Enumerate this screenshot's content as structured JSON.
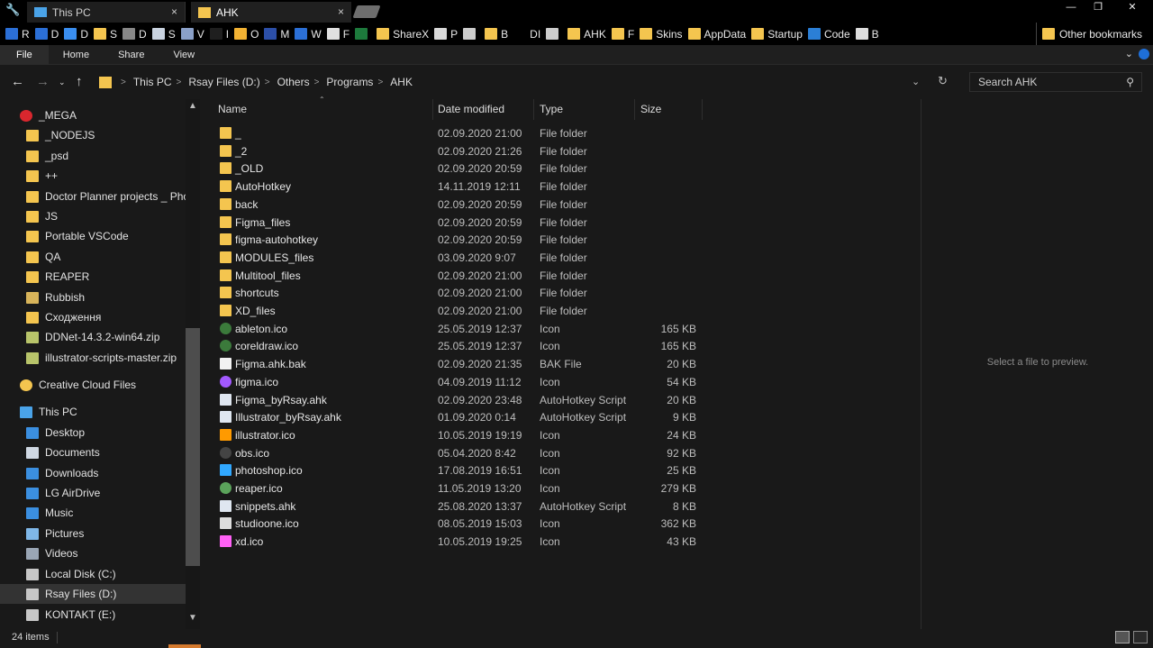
{
  "tabs": {
    "inactive_label": "This PC",
    "active_label": "AHK",
    "close_glyph": "×"
  },
  "window_controls": {
    "minimize": "—",
    "maximize": "❐",
    "close": "✕"
  },
  "bookmarks": [
    {
      "label": "R",
      "color": "#2b6fd6"
    },
    {
      "label": "D",
      "color": "#2b6fd6"
    },
    {
      "label": "D",
      "color": "#3a8ef0"
    },
    {
      "label": "S",
      "color": "#f4c54f"
    },
    {
      "label": "D",
      "color": "#888888"
    },
    {
      "label": "S",
      "color": "#c9d3e0"
    },
    {
      "label": "V",
      "color": "#8aa0c8"
    },
    {
      "label": "I",
      "color": "#1f1f1f"
    },
    {
      "label": "O",
      "color": "#f2b233"
    },
    {
      "label": "M",
      "color": "#2c4fa8"
    },
    {
      "label": "W",
      "color": "#2b6fd6"
    },
    {
      "label": "F",
      "color": "#e0e0e0"
    },
    {
      "label": "",
      "color": "#1d7a3c"
    },
    {
      "label": "ShareX",
      "color": "#f4c54f"
    },
    {
      "label": "P",
      "color": "#d9d9d9"
    },
    {
      "label": "",
      "color": "#cccccc"
    },
    {
      "label": "B",
      "color": "#f4c54f"
    },
    {
      "label": "DI",
      "color": "#000000"
    },
    {
      "label": "",
      "color": "#cccccc"
    },
    {
      "label": "AHK",
      "color": "#f4c54f"
    },
    {
      "label": "F",
      "color": "#f4c54f"
    },
    {
      "label": "Skins",
      "color": "#f4c54f"
    },
    {
      "label": "AppData",
      "color": "#f4c54f"
    },
    {
      "label": "Startup",
      "color": "#f4c54f"
    },
    {
      "label": "Code",
      "color": "#2b7fd6"
    },
    {
      "label": "B",
      "color": "#dddddd"
    }
  ],
  "other_bookmarks": "Other bookmarks",
  "ribbon": {
    "file": "File",
    "home": "Home",
    "share": "Share",
    "view": "View"
  },
  "address": {
    "crumbs": [
      "This PC",
      "Rsay Files (D:)",
      "Others",
      "Programs",
      "AHK"
    ],
    "separator": ">"
  },
  "search": {
    "placeholder": "Search AHK"
  },
  "nav_pane": {
    "items": [
      {
        "label": "_MEGA",
        "icon": "mega-icon",
        "color": "#d9272e",
        "indent": 0
      },
      {
        "label": "_NODEJS",
        "icon": "folder-sync-icon",
        "color": "#f4c54f",
        "indent": 1
      },
      {
        "label": "_psd",
        "icon": "folder-sync-icon",
        "color": "#f4c54f",
        "indent": 1
      },
      {
        "label": "++",
        "icon": "folder-sync-icon",
        "color": "#f4c54f",
        "indent": 1
      },
      {
        "label": "Doctor Planner projects _ Photo",
        "icon": "folder-icon",
        "color": "#f4c54f",
        "indent": 1
      },
      {
        "label": "JS",
        "icon": "folder-sync-icon",
        "color": "#f4c54f",
        "indent": 1
      },
      {
        "label": "Portable VSCode",
        "icon": "folder-sync-icon",
        "color": "#f4c54f",
        "indent": 1
      },
      {
        "label": "QA",
        "icon": "folder-sync-icon",
        "color": "#f4c54f",
        "indent": 1
      },
      {
        "label": "REAPER",
        "icon": "folder-sync-icon",
        "color": "#f4c54f",
        "indent": 1
      },
      {
        "label": "Rubbish",
        "icon": "folder-icon",
        "color": "#d8b45a",
        "indent": 1
      },
      {
        "label": "Сходження",
        "icon": "folder-sync-icon",
        "color": "#f4c54f",
        "indent": 1
      },
      {
        "label": "DDNet-14.3.2-win64.zip",
        "icon": "zip-icon",
        "color": "#b8c46a",
        "indent": 1
      },
      {
        "label": "illustrator-scripts-master.zip",
        "icon": "zip-icon",
        "color": "#b8c46a",
        "indent": 1
      },
      {
        "label": "Creative Cloud Files",
        "icon": "creative-cloud-icon",
        "color": "#f4c54f",
        "indent": 0
      },
      {
        "label": "This PC",
        "icon": "computer-icon",
        "color": "#4aa3e8",
        "indent": 0
      },
      {
        "label": "Desktop",
        "icon": "desktop-icon",
        "color": "#3b8fe0",
        "indent": 1
      },
      {
        "label": "Documents",
        "icon": "documents-icon",
        "color": "#cfd8e3",
        "indent": 1
      },
      {
        "label": "Downloads",
        "icon": "downloads-icon",
        "color": "#3b8fe0",
        "indent": 1
      },
      {
        "label": "LG AirDrive",
        "icon": "drive-icon",
        "color": "#3b8fe0",
        "indent": 1
      },
      {
        "label": "Music",
        "icon": "music-icon",
        "color": "#3b8fe0",
        "indent": 1
      },
      {
        "label": "Pictures",
        "icon": "pictures-icon",
        "color": "#7fb7e8",
        "indent": 1
      },
      {
        "label": "Videos",
        "icon": "videos-icon",
        "color": "#9aa6b5",
        "indent": 1
      },
      {
        "label": "Local Disk (C:)",
        "icon": "disk-icon",
        "color": "#c7c7c7",
        "indent": 1
      },
      {
        "label": "Rsay Files (D:)",
        "icon": "disk-icon",
        "color": "#c7c7c7",
        "indent": 1,
        "selected": true
      },
      {
        "label": "KONTAKT (E:)",
        "icon": "disk-icon",
        "color": "#c7c7c7",
        "indent": 1
      }
    ]
  },
  "columns": {
    "name": "Name",
    "date": "Date modified",
    "type": "Type",
    "size": "Size"
  },
  "files": [
    {
      "name": "_",
      "date": "02.09.2020 21:00",
      "type": "File folder",
      "size": "",
      "icon": "folder-icon",
      "color": "#f4c54f"
    },
    {
      "name": "_2",
      "date": "02.09.2020 21:26",
      "type": "File folder",
      "size": "",
      "icon": "folder-icon",
      "color": "#f4c54f"
    },
    {
      "name": "_OLD",
      "date": "02.09.2020 20:59",
      "type": "File folder",
      "size": "",
      "icon": "folder-icon",
      "color": "#f4c54f"
    },
    {
      "name": "AutoHotkey",
      "date": "14.11.2019 12:11",
      "type": "File folder",
      "size": "",
      "icon": "folder-icon",
      "color": "#f4c54f"
    },
    {
      "name": "back",
      "date": "02.09.2020 20:59",
      "type": "File folder",
      "size": "",
      "icon": "folder-icon",
      "color": "#f4c54f"
    },
    {
      "name": "Figma_files",
      "date": "02.09.2020 20:59",
      "type": "File folder",
      "size": "",
      "icon": "folder-icon",
      "color": "#f4c54f"
    },
    {
      "name": "figma-autohotkey",
      "date": "02.09.2020 20:59",
      "type": "File folder",
      "size": "",
      "icon": "folder-icon",
      "color": "#f4c54f"
    },
    {
      "name": "MODULES_files",
      "date": "03.09.2020 9:07",
      "type": "File folder",
      "size": "",
      "icon": "folder-icon",
      "color": "#f4c54f"
    },
    {
      "name": "Multitool_files",
      "date": "02.09.2020 21:00",
      "type": "File folder",
      "size": "",
      "icon": "folder-icon",
      "color": "#f4c54f"
    },
    {
      "name": "shortcuts",
      "date": "02.09.2020 21:00",
      "type": "File folder",
      "size": "",
      "icon": "folder-icon",
      "color": "#f4c54f"
    },
    {
      "name": "XD_files",
      "date": "02.09.2020 21:00",
      "type": "File folder",
      "size": "",
      "icon": "folder-icon",
      "color": "#f4c54f"
    },
    {
      "name": "ableton.ico",
      "date": "25.05.2019 12:37",
      "type": "Icon",
      "size": "165 KB",
      "icon": "ableton-icon",
      "color": "#3b7a3b"
    },
    {
      "name": "coreldraw.ico",
      "date": "25.05.2019 12:37",
      "type": "Icon",
      "size": "165 KB",
      "icon": "coreldraw-icon",
      "color": "#3b7a3b"
    },
    {
      "name": "Figma.ahk.bak",
      "date": "02.09.2020 21:35",
      "type": "BAK File",
      "size": "20 KB",
      "icon": "file-icon",
      "color": "#f2f2f2"
    },
    {
      "name": "figma.ico",
      "date": "04.09.2019 11:12",
      "type": "Icon",
      "size": "54 KB",
      "icon": "figma-icon",
      "color": "#a259ff"
    },
    {
      "name": "Figma_byRsay.ahk",
      "date": "02.09.2020 23:48",
      "type": "AutoHotkey Script",
      "size": "20 KB",
      "icon": "ahk-script-icon",
      "color": "#dfe6f0"
    },
    {
      "name": "Illustrator_byRsay.ahk",
      "date": "01.09.2020 0:14",
      "type": "AutoHotkey Script",
      "size": "9 KB",
      "icon": "ahk-script-icon",
      "color": "#dfe6f0"
    },
    {
      "name": "illustrator.ico",
      "date": "10.05.2019 19:19",
      "type": "Icon",
      "size": "24 KB",
      "icon": "illustrator-icon",
      "color": "#ff9a00"
    },
    {
      "name": "obs.ico",
      "date": "05.04.2020 8:42",
      "type": "Icon",
      "size": "92 KB",
      "icon": "obs-icon",
      "color": "#444444"
    },
    {
      "name": "photoshop.ico",
      "date": "17.08.2019 16:51",
      "type": "Icon",
      "size": "25 KB",
      "icon": "photoshop-icon",
      "color": "#31a8ff"
    },
    {
      "name": "reaper.ico",
      "date": "11.05.2019 13:20",
      "type": "Icon",
      "size": "279 KB",
      "icon": "reaper-icon",
      "color": "#5ba35b"
    },
    {
      "name": "snippets.ahk",
      "date": "25.08.2020 13:37",
      "type": "AutoHotkey Script",
      "size": "8 KB",
      "icon": "ahk-script-icon",
      "color": "#dfe6f0"
    },
    {
      "name": "studioone.ico",
      "date": "08.05.2019 15:03",
      "type": "Icon",
      "size": "362 KB",
      "icon": "studioone-icon",
      "color": "#dddddd"
    },
    {
      "name": "xd.ico",
      "date": "10.05.2019 19:25",
      "type": "Icon",
      "size": "43 KB",
      "icon": "xd-icon",
      "color": "#ff61f6"
    }
  ],
  "preview": {
    "message": "Select a file to preview."
  },
  "status": {
    "count": "24 items"
  }
}
